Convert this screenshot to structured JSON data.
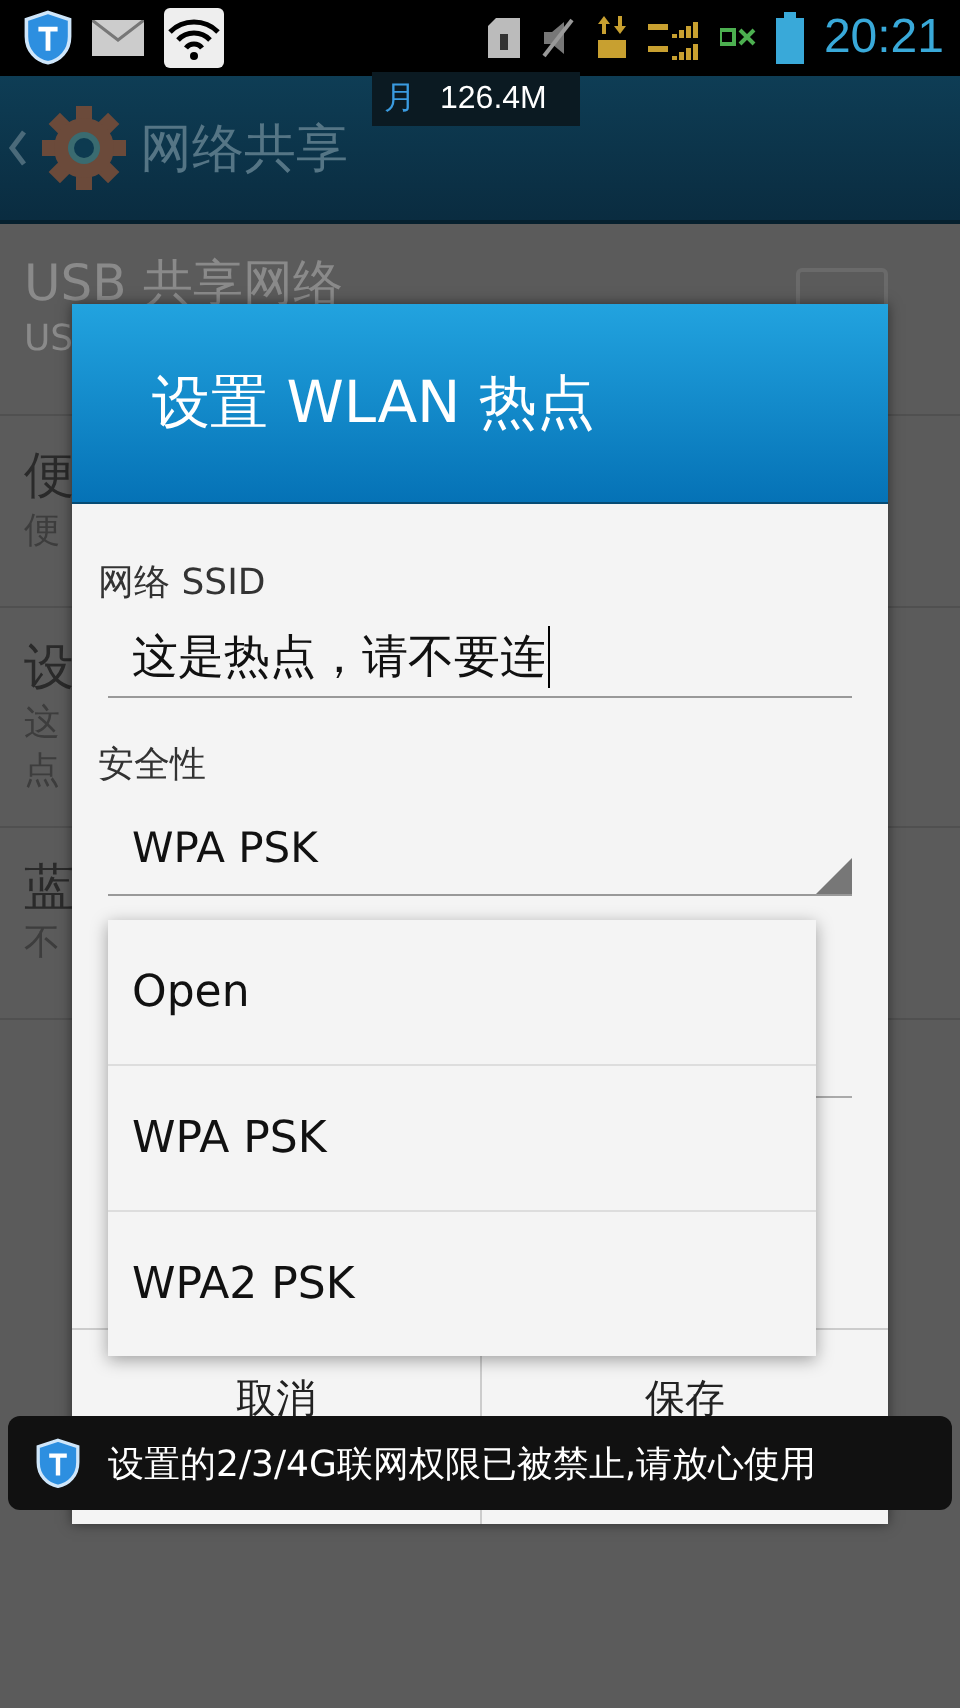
{
  "status_bar": {
    "time": "20:21"
  },
  "traffic_float": {
    "period": "月",
    "amount": "126.4M"
  },
  "action_bar": {
    "title": "网络共享"
  },
  "background_rows": [
    {
      "title": "USB 共享网络",
      "summary": [
        "US"
      ],
      "disabled": true,
      "checkbox": {
        "checked": false
      }
    },
    {
      "title": "便",
      "summary": [
        "便"
      ],
      "disabled": false
    },
    {
      "title": "设",
      "summary": [
        "这",
        "点"
      ],
      "disabled": false
    },
    {
      "title": "蓝",
      "summary": [
        "不"
      ],
      "disabled": false
    }
  ],
  "dialog": {
    "title": "设置 WLAN 热点",
    "ssid_label": "网络 SSID",
    "ssid_value": "这是热点，请不要连",
    "security_label": "安全性",
    "security_value": "WPA PSK",
    "options": [
      {
        "label": "Open"
      },
      {
        "label": "WPA PSK"
      },
      {
        "label": "WPA2 PSK"
      }
    ],
    "buttons": [
      "取消",
      "保存"
    ]
  },
  "toast": {
    "message": "设置的2/3/4G联网权限已被禁止,请放心使用"
  }
}
